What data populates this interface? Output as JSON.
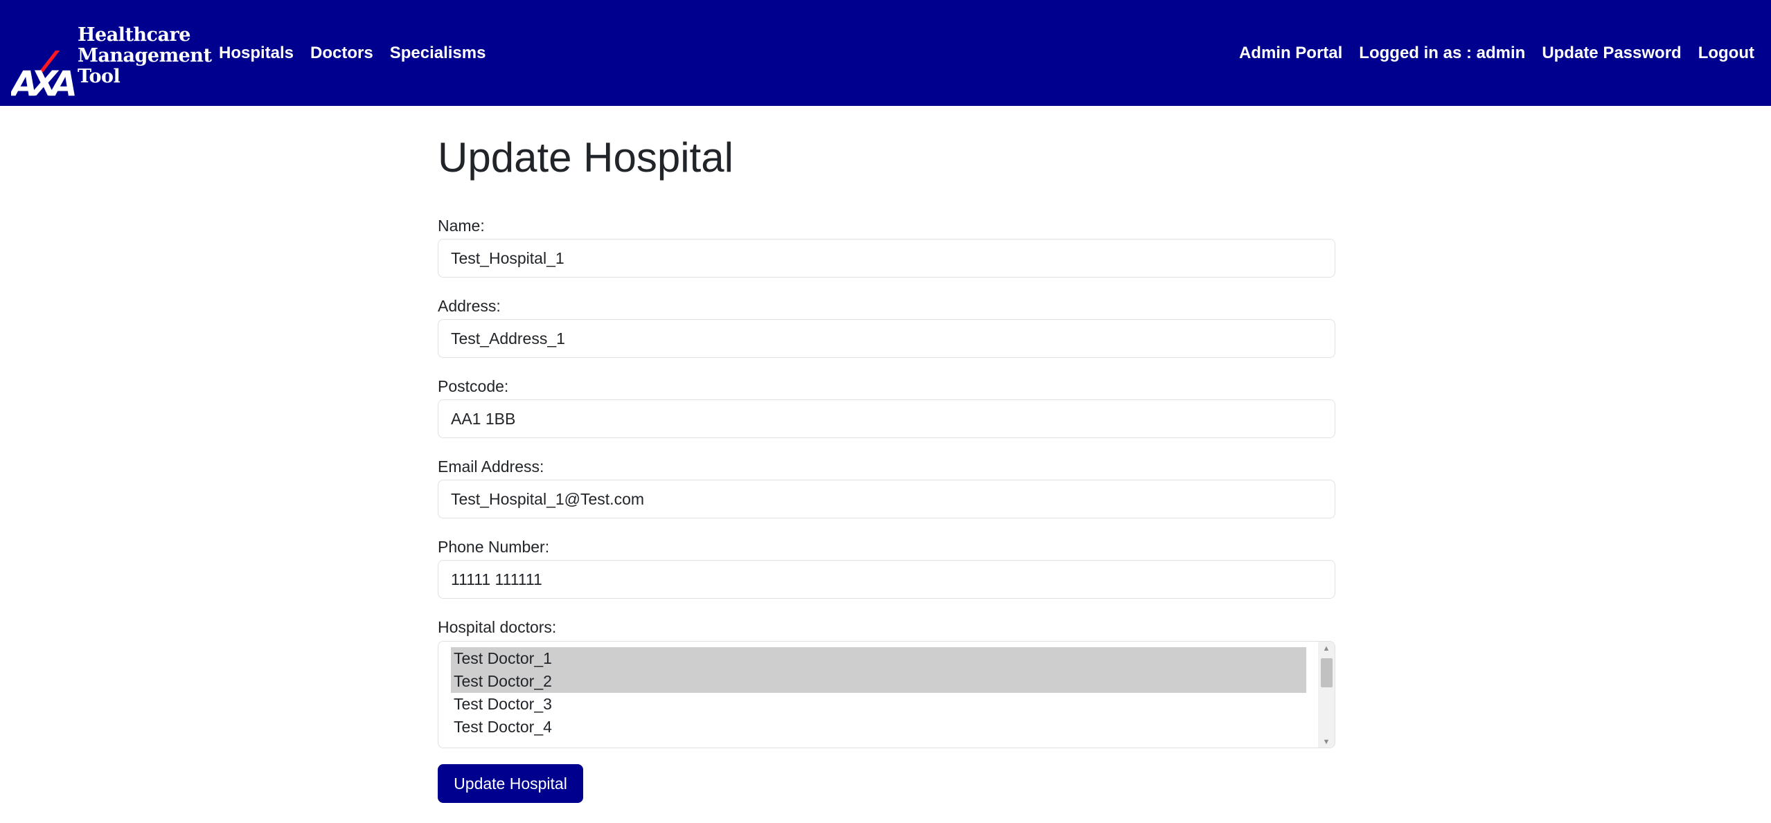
{
  "brand": {
    "logo_text": "AXA",
    "line1": "Healthcare",
    "line2": "Management",
    "line3": "Tool",
    "colors": {
      "navbar": "#00008f",
      "logo_slash": "#ff1721"
    }
  },
  "nav": {
    "left": [
      "Hospitals",
      "Doctors",
      "Specialisms"
    ],
    "right": [
      "Admin Portal",
      "Logged in as : admin",
      "Update Password",
      "Logout"
    ]
  },
  "page": {
    "title": "Update Hospital"
  },
  "form": {
    "name": {
      "label": "Name:",
      "value": "Test_Hospital_1"
    },
    "address": {
      "label": "Address:",
      "value": "Test_Address_1"
    },
    "postcode": {
      "label": "Postcode:",
      "value": "AA1 1BB"
    },
    "email": {
      "label": "Email Address:",
      "value": "Test_Hospital_1@Test.com"
    },
    "phone": {
      "label": "Phone Number:",
      "value": "11111 111111"
    },
    "doctors": {
      "label": "Hospital doctors:",
      "options": [
        {
          "label": "Test Doctor_1",
          "selected": true
        },
        {
          "label": "Test Doctor_2",
          "selected": true
        },
        {
          "label": "Test Doctor_3",
          "selected": false
        },
        {
          "label": "Test Doctor_4",
          "selected": false
        }
      ]
    },
    "submit_label": "Update Hospital"
  }
}
